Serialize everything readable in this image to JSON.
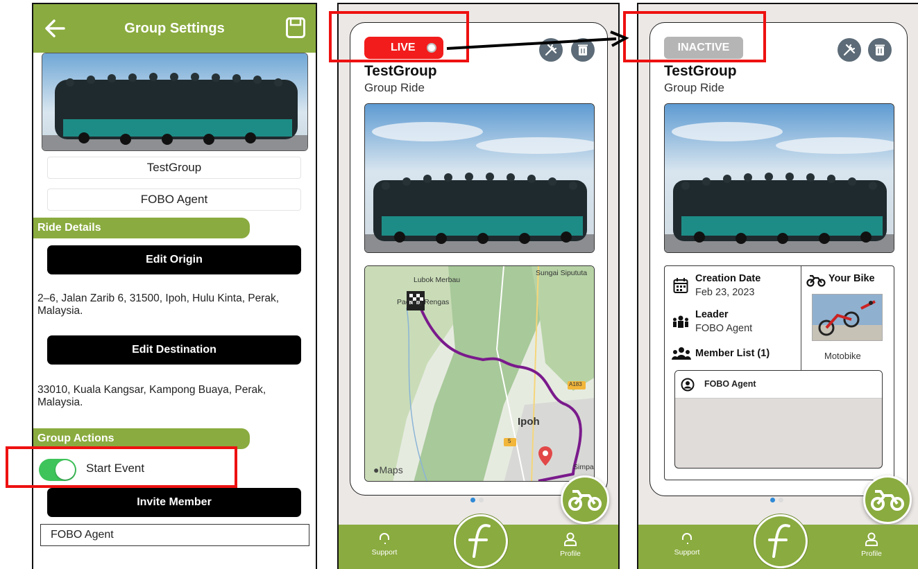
{
  "screen1": {
    "header": {
      "title": "Group Settings",
      "back_icon": "arrow-left-icon",
      "save_icon": "floppy-disk-icon"
    },
    "group_name": "TestGroup",
    "leader_name": "FOBO Agent",
    "ride_details": {
      "heading": "Ride Details",
      "edit_origin_label": "Edit Origin",
      "origin_address": "2–6, Jalan Zarib 6, 31500, Ipoh, Hulu Kinta, Perak, Malaysia.",
      "edit_destination_label": "Edit Destination",
      "destination_address": "33010, Kuala Kangsar, Kampong Buaya, Perak, Malaysia."
    },
    "group_actions": {
      "heading": "Group Actions",
      "start_event_label": "Start Event",
      "start_event_on": true,
      "invite_member_label": "Invite Member",
      "member_field_value": "FOBO Agent"
    }
  },
  "screen2": {
    "status_badge": "LIVE",
    "status_color": "#f21c1c",
    "group_name": "TestGroup",
    "group_type": "Group Ride",
    "map": {
      "labels": {
        "lubok_merbau": "Lubok Merbau",
        "sungai_siput": "Sungai Sipututa",
        "padang_rengas": "Padang Rengas",
        "ipoh": "Ipoh",
        "simpang": "Simpa",
        "road_a183": "A183",
        "road_5": "5"
      },
      "attribution": "Maps"
    },
    "page_dots": {
      "count": 2,
      "active": 0
    },
    "nav": {
      "support_label": "Support",
      "profile_label": "Profile"
    }
  },
  "screen3": {
    "status_badge": "INACTIVE",
    "status_color": "#b5b5b5",
    "group_name": "TestGroup",
    "group_type": "Group Ride",
    "details": {
      "creation_date_label": "Creation Date",
      "creation_date_value": "Feb 23, 2023",
      "leader_label": "Leader",
      "leader_value": "FOBO Agent",
      "member_list_label": "Member List (1)",
      "your_bike_label": "Your Bike",
      "bike_name": "Motobike",
      "members": [
        "FOBO Agent"
      ]
    },
    "page_dots": {
      "count": 2,
      "active": 0
    },
    "nav": {
      "support_label": "Support",
      "profile_label": "Profile"
    }
  },
  "colors": {
    "brand_green": "#8aab3f",
    "toggle_on": "#3ec45a",
    "annotation_red": "#ee1111",
    "action_icon_gray": "#5c6b77"
  }
}
